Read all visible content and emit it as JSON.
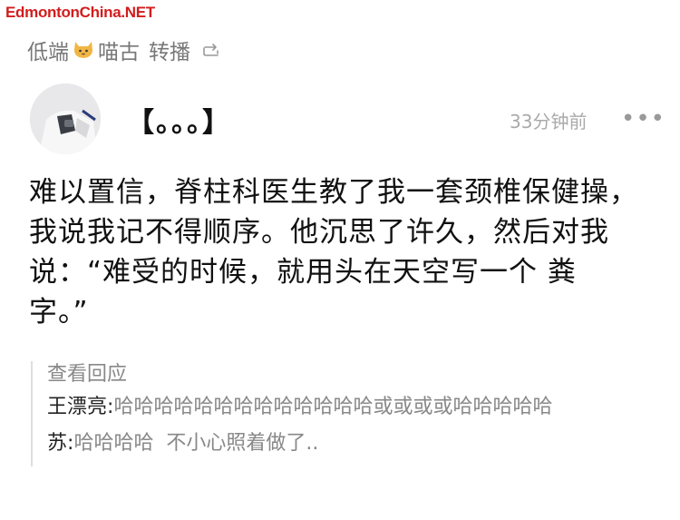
{
  "watermark": "EdmontonChina.NET",
  "repost": {
    "user_a": "低端",
    "user_b": "喵古",
    "action": "转播"
  },
  "post": {
    "author": "【。。。】",
    "time": "33分钟前",
    "more": "•••",
    "body": "难以置信，脊柱科医生教了我一套颈椎保健操，我说我记不得顺序。他沉思了许久，然后对我说：“难受的时候，就用头在天空写一个 粪 字。”"
  },
  "replies": {
    "view_label": "查看回应",
    "items": [
      {
        "name": "王漂亮",
        "text": "哈哈哈哈哈哈哈哈哈哈哈哈哈或或或或哈哈哈哈哈"
      },
      {
        "name": "苏",
        "text": "哈哈哈哈  不小心照着做了.."
      }
    ]
  },
  "colors": {
    "watermark": "#d21d1d",
    "secondary_text": "#888888",
    "time_text": "#aaaaaa"
  }
}
